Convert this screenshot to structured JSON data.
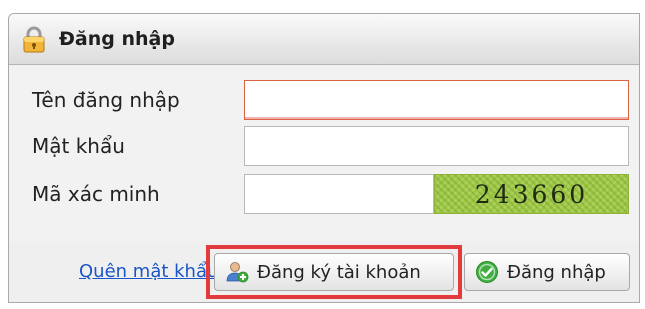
{
  "panel": {
    "title": "Đăng nhập"
  },
  "form": {
    "username_label": "Tên đăng nhập",
    "password_label": "Mật khẩu",
    "captcha_label": "Mã xác minh",
    "captcha_code": "243660"
  },
  "footer": {
    "forgot_password": "Quên mật khẩu",
    "register_button": "Đăng ký tài khoản",
    "login_button": "Đăng nhập"
  },
  "icons": {
    "header": "lock-icon",
    "register": "add-user-icon",
    "login": "check-circle-icon"
  },
  "colors": {
    "link": "#1a55c8",
    "highlight": "#e23b3b",
    "captcha_bg": "#9fc84a",
    "invalid_border": "#d66440",
    "check": "#3fae3f"
  }
}
